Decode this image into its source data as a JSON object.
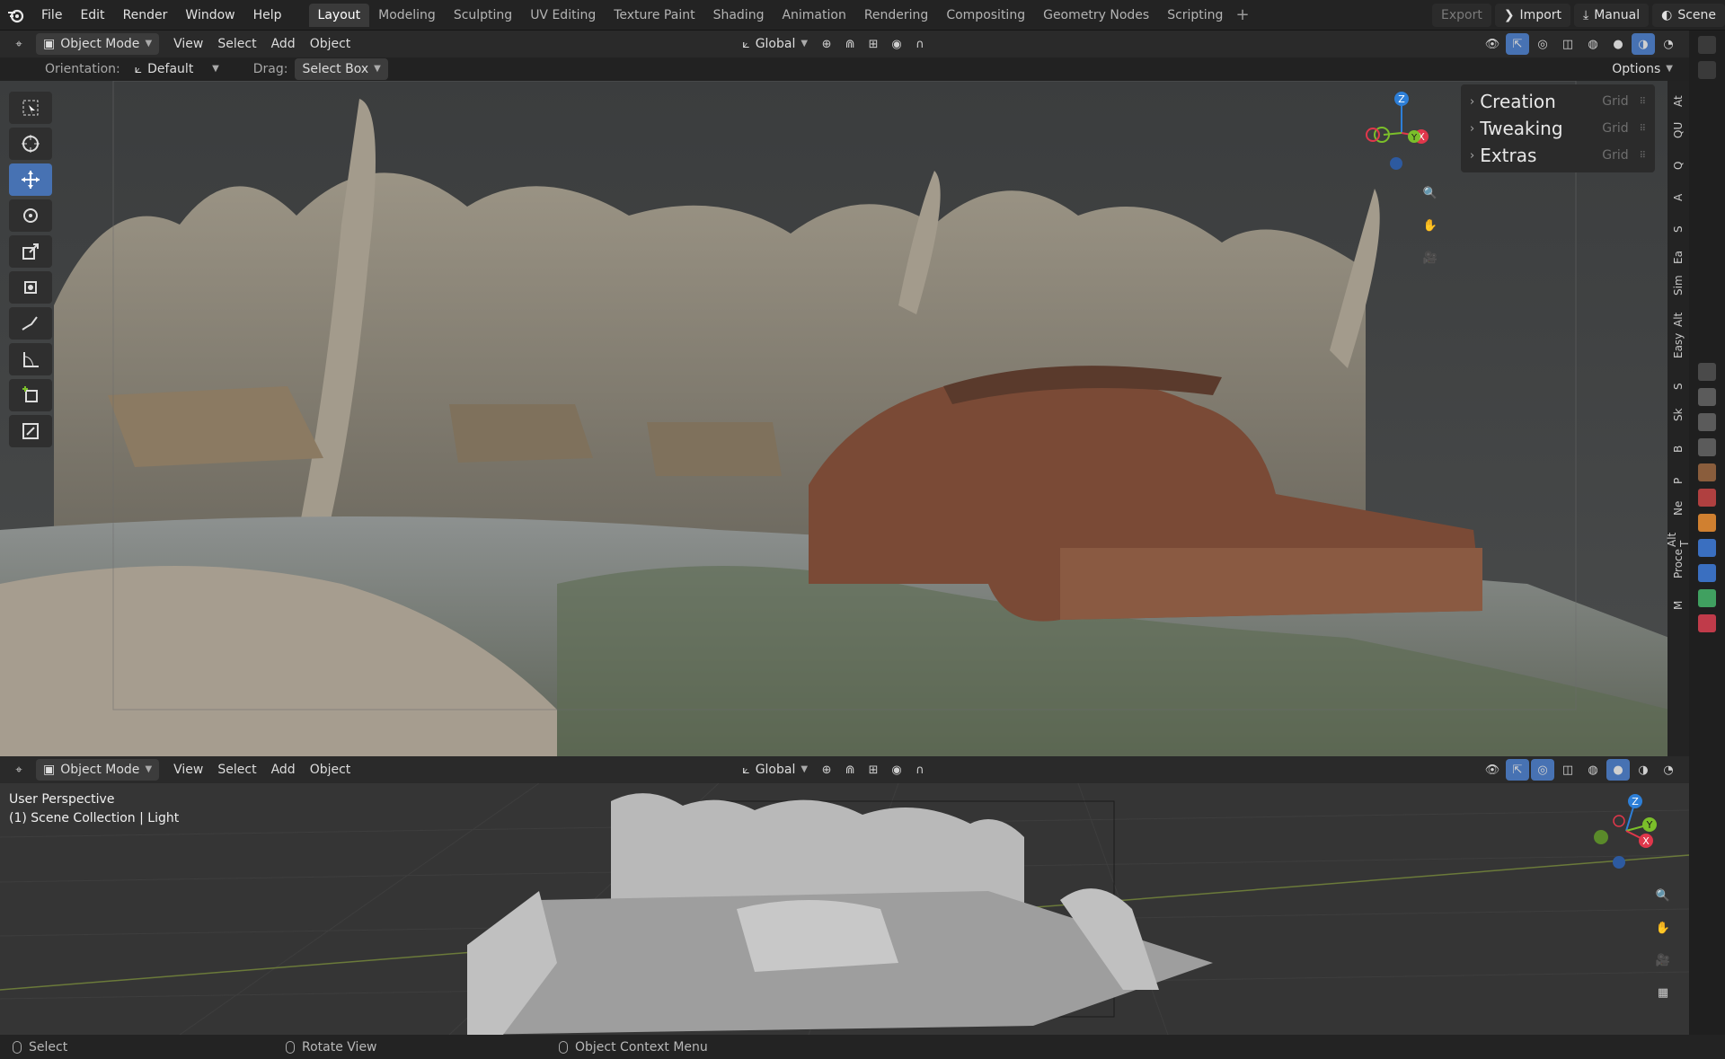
{
  "menubar": {
    "items": [
      "File",
      "Edit",
      "Render",
      "Window",
      "Help"
    ],
    "workspaces": [
      "Layout",
      "Modeling",
      "Sculpting",
      "UV Editing",
      "Texture Paint",
      "Shading",
      "Animation",
      "Rendering",
      "Compositing",
      "Geometry Nodes",
      "Scripting"
    ],
    "active_workspace": "Layout",
    "export_label": "Export",
    "import_label": "Import",
    "manual_label": "Manual",
    "scene_label": "Scene"
  },
  "viewport_header": {
    "mode": "Object Mode",
    "menus": [
      "View",
      "Select",
      "Add",
      "Object"
    ],
    "transform_orientation": "Global",
    "options_label": "Options"
  },
  "tool_settings": {
    "orientation_label": "Orientation:",
    "orientation_value": "Default",
    "drag_label": "Drag:",
    "drag_value": "Select Box"
  },
  "n_panel": {
    "sections": [
      {
        "title": "Creation",
        "grid_label": "Grid"
      },
      {
        "title": "Tweaking",
        "grid_label": "Grid"
      },
      {
        "title": "Extras",
        "grid_label": "Grid"
      }
    ]
  },
  "gizmo": {
    "z": "Z",
    "y": "Y",
    "x": "X"
  },
  "side_tabs": [
    "At",
    "QU",
    "Q",
    "A",
    "S",
    "Ea",
    "Sim",
    "Alt",
    "Easy",
    "S",
    "Sk",
    "B",
    "P",
    "Ne",
    "Alt T",
    "Proce",
    "M"
  ],
  "viewport2_header": {
    "mode": "Object Mode",
    "menus": [
      "View",
      "Select",
      "Add",
      "Object"
    ],
    "transform_orientation": "Global"
  },
  "viewport2_info": {
    "perspective": "User Perspective",
    "collection": "(1) Scene Collection | Light"
  },
  "statusbar": {
    "items": [
      "Select",
      "Rotate View",
      "Object Context Menu"
    ]
  },
  "colors": {
    "accent": "#4772b3",
    "axis_x": "#e0374b",
    "axis_y": "#7bbf2a",
    "axis_z": "#2d7fd8"
  }
}
